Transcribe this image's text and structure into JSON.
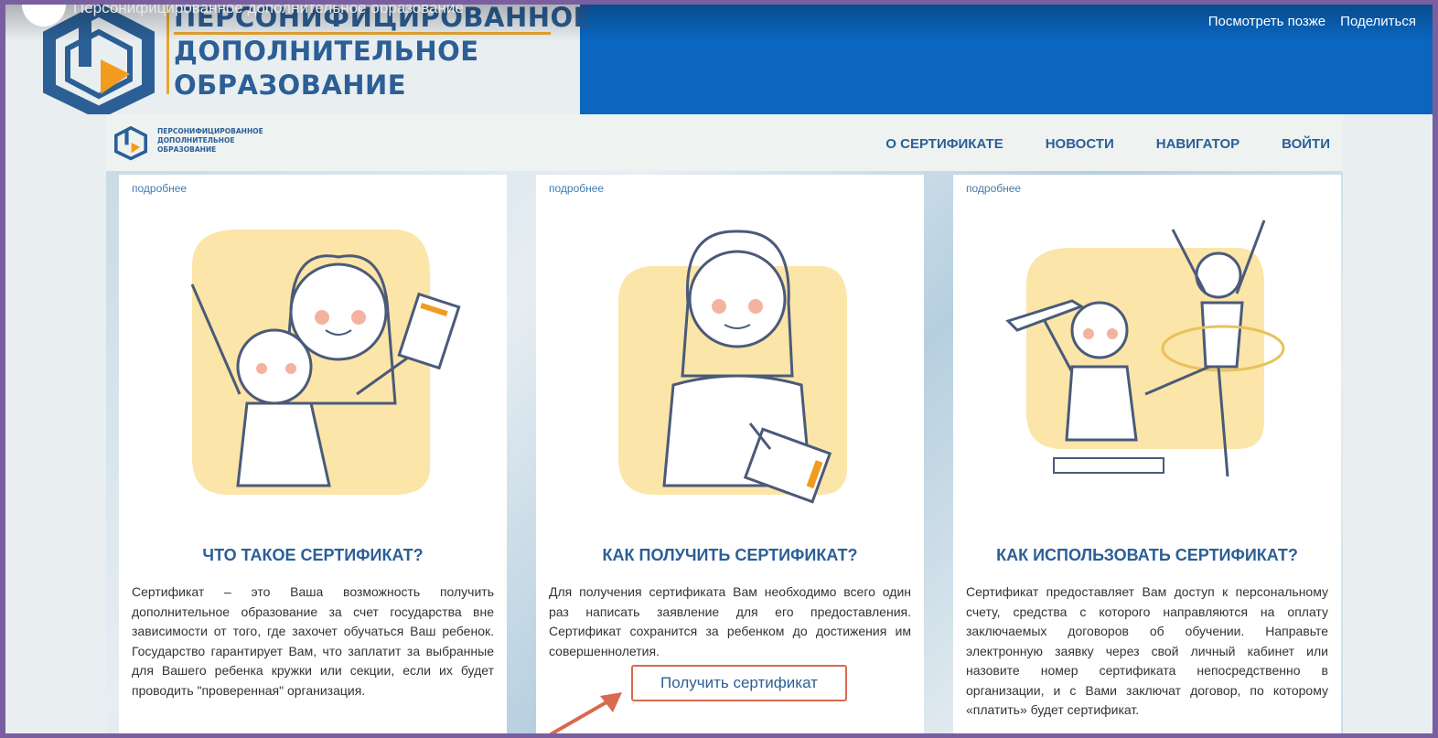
{
  "video": {
    "title": "Персонифицированное дополнительное образование",
    "watch_later": "Посмотреть позже",
    "share": "Поделиться"
  },
  "brand": {
    "line1": "ПЕРСОНИФИЦИРОВАННОЕ",
    "line2": "ДОПОЛНИТЕЛЬНОЕ",
    "line3": "ОБРАЗОВАНИЕ"
  },
  "nav": {
    "about": "О СЕРТИФИКАТЕ",
    "news": "НОВОСТИ",
    "navigator": "НАВИГАТОР",
    "login": "ВОЙТИ"
  },
  "cards": [
    {
      "more": "подробнее",
      "title": "ЧТО ТАКОЕ СЕРТИФИКАТ?",
      "text": "Сертификат – это Ваша возможность получить дополнительное образование за счет государства вне зависимости от того, где захочет обучаться Ваш ребенок. Государство гарантирует Вам, что заплатит за выбранные для Вашего ребенка кружки или секции, если их будет проводить \"проверенная\" организация."
    },
    {
      "more": "подробнее",
      "title": "КАК ПОЛУЧИТЬ СЕРТИФИКАТ?",
      "text": "Для получения сертификата Вам необходимо всего один раз написать заявление для его предоставления. Сертификат сохранится за ребенком до достижения им совершеннолетия.",
      "button": "Получить сертификат"
    },
    {
      "more": "подробнее",
      "title": "КАК ИСПОЛЬЗОВАТЬ СЕРТИФИКАТ?",
      "text": "Сертификат предоставляет Вам доступ к персональному счету, средства с которого направляются на оплату заключаемых договоров об обучении. Направьте электронную заявку через свой личный кабинет или назовите номер сертификата непосредственно в организации, и с Вами заключат договор, по которому «платить» будет сертификат."
    }
  ],
  "colors": {
    "brand_blue": "#2b5f96",
    "accent_orange": "#e8a531",
    "header_blue": "#0a66bf",
    "highlight_red": "#d9694f"
  }
}
